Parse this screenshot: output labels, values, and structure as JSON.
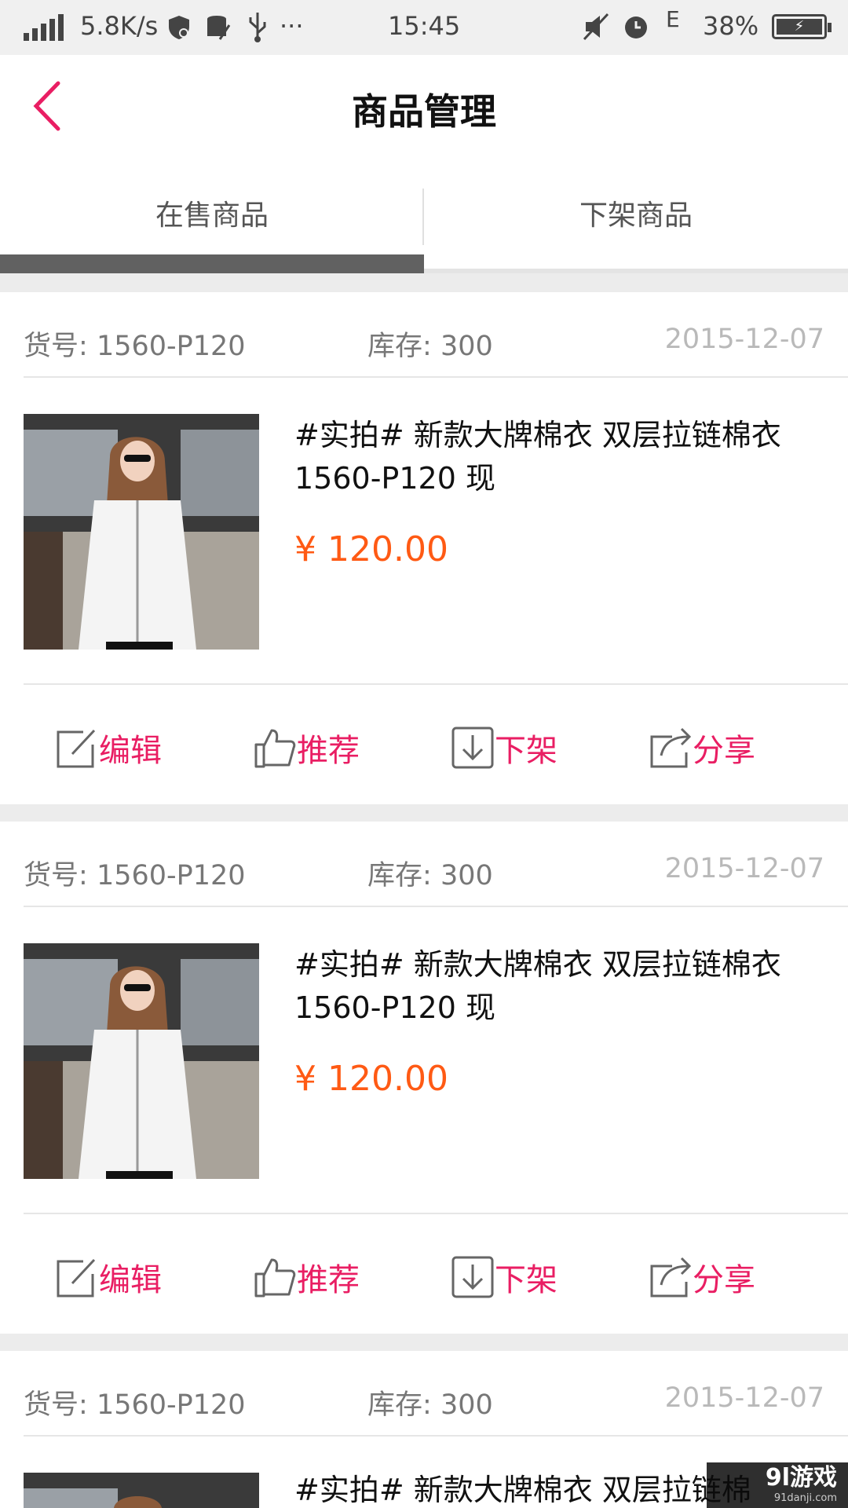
{
  "status_bar": {
    "speed": "5.8K/s",
    "dots": "···",
    "time": "15:45",
    "network": "E",
    "battery": "38%",
    "icons": [
      "signal-icon",
      "shield-icon",
      "storage-icon",
      "usb-icon",
      "mute-icon",
      "alarm-icon",
      "battery-icon"
    ]
  },
  "header": {
    "title": "商品管理",
    "back_icon": "chevron-left-icon"
  },
  "tabs": [
    {
      "label": "在售商品",
      "active": true
    },
    {
      "label": "下架商品",
      "active": false
    }
  ],
  "colors": {
    "accent": "#e91e63",
    "price": "#ff5a14",
    "tab_indicator": "#616161",
    "date": "#b9b9b9"
  },
  "products": [
    {
      "sku_label": "货号:",
      "sku": "1560-P120",
      "stock_label": "库存:",
      "stock": "300",
      "date": "2015-12-07",
      "name": "#实拍# 新款大牌棉衣 双层拉链棉衣 1560-P120 现",
      "price": "¥ 120.00"
    },
    {
      "sku_label": "货号:",
      "sku": "1560-P120",
      "stock_label": "库存:",
      "stock": "300",
      "date": "2015-12-07",
      "name": "#实拍# 新款大牌棉衣 双层拉链棉衣 1560-P120 现",
      "price": "¥ 120.00"
    },
    {
      "sku_label": "货号:",
      "sku": "1560-P120",
      "stock_label": "库存:",
      "stock": "300",
      "date": "2015-12-07",
      "name": "#实拍# 新款大牌棉衣 双层拉链棉",
      "price": ""
    }
  ],
  "actions": [
    {
      "label": "编辑",
      "icon": "edit-icon"
    },
    {
      "label": "推荐",
      "icon": "thumbs-up-icon"
    },
    {
      "label": "下架",
      "icon": "download-icon"
    },
    {
      "label": "分享",
      "icon": "share-icon"
    }
  ],
  "watermark": {
    "text": "9l游戏",
    "sub": "91danji.com"
  }
}
